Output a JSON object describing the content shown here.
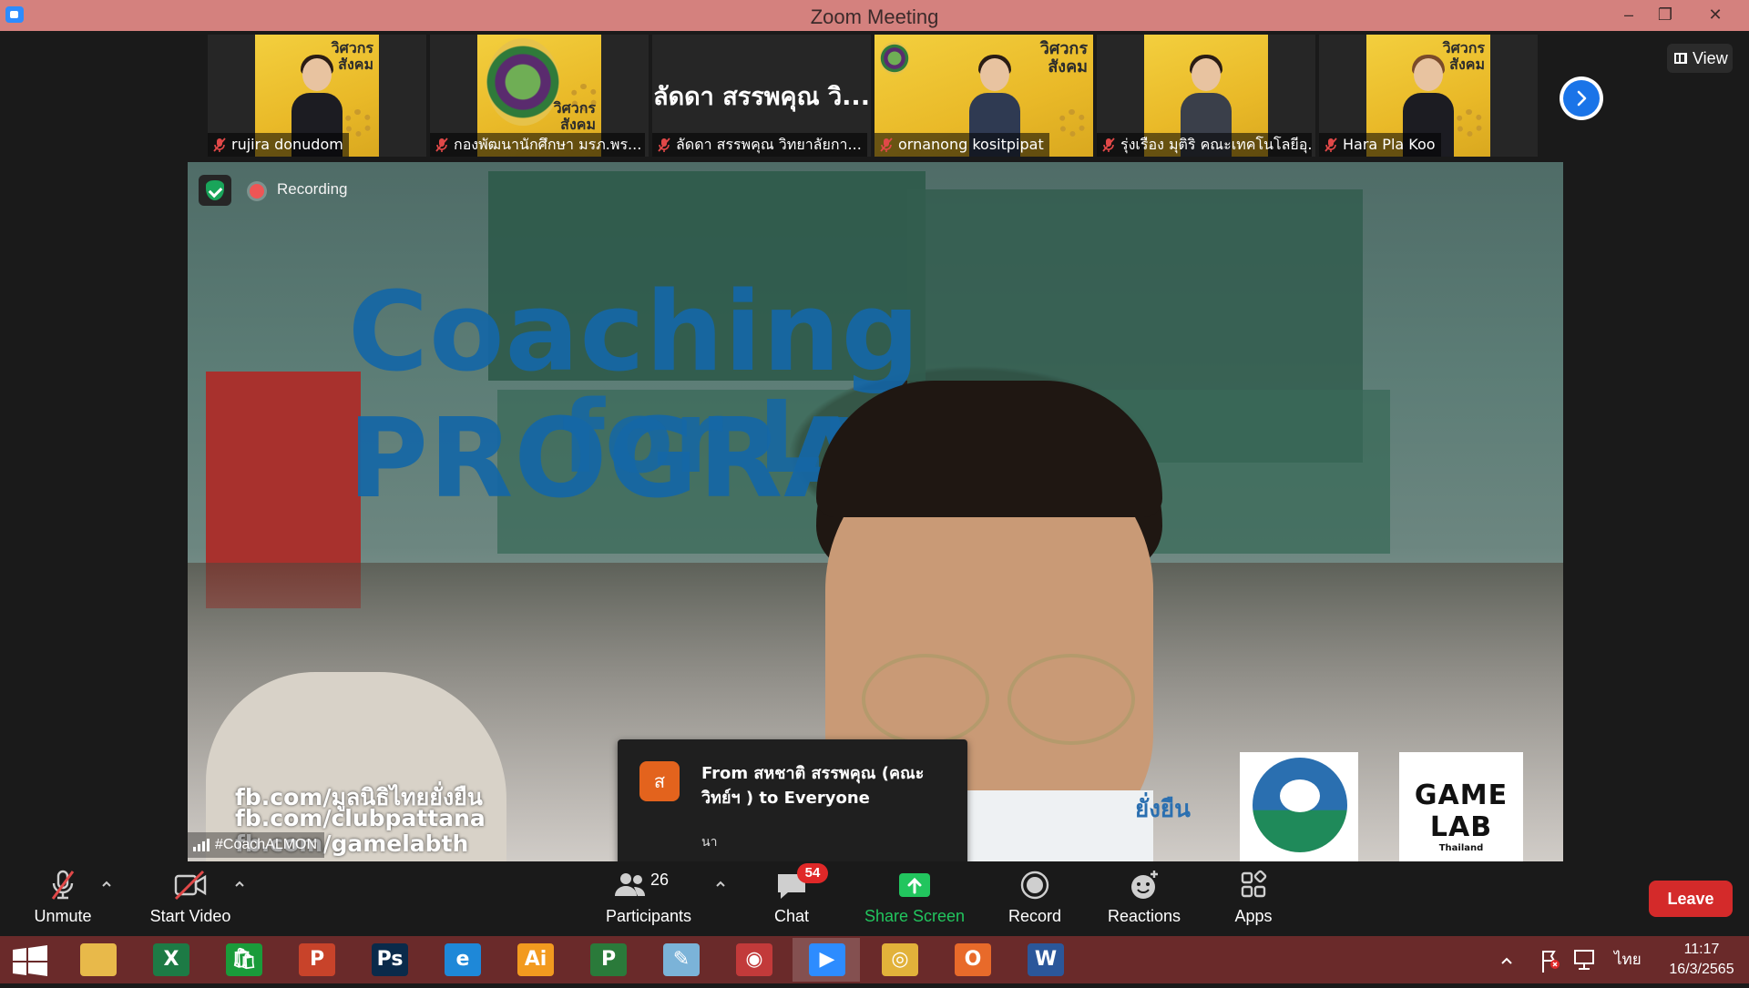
{
  "window": {
    "title": "Zoom Meeting",
    "minimize_glyph": "–",
    "restore_glyph": "❐",
    "close_glyph": "✕"
  },
  "gallery": {
    "view_label": "View",
    "tiles": [
      {
        "name": "rujira donudom",
        "muted": true
      },
      {
        "name": "กองพัฒนานักศึกษา มรภ.พร...",
        "muted": true
      },
      {
        "name": "ลัดดา สรรพคุณ วิทยาลัยกา...",
        "display_title": "ลัดดา สรรพคุณ วิ...",
        "muted": true
      },
      {
        "name": "ornanong kositpipat",
        "muted": true
      },
      {
        "name": "รุ่งเรือง มุติริ คณะเทคโนโลยีอุ...",
        "muted": true
      },
      {
        "name": "Hara Pla Koo",
        "muted": true
      }
    ],
    "tile_logo_text": "วิศวกร สังคม"
  },
  "main_video": {
    "recording_label": "Recording",
    "speaker_name": "#CoachALMON",
    "slide_title": "Coaching PROGRAM",
    "slide_subtitle": "for Lr",
    "fb_lines": [
      "fb.com/มูลนิธิไทยยั่งยืน",
      "fb.com/clubpattana",
      "fb.com/gamelabth"
    ],
    "logo_yy": "ยั่งยืน",
    "logo_game_main": "GAME LAB",
    "logo_game_sub": "Thailand"
  },
  "chat_toast": {
    "avatar_letter": "ส",
    "from_text": "From สหชาติ สรรพคุณ (คณะวิทย์ฯ ) to Everyone",
    "message": "นา"
  },
  "toolbar": {
    "unmute": "Unmute",
    "start_video": "Start Video",
    "participants": "Participants",
    "participants_count": "26",
    "chat": "Chat",
    "chat_badge": "54",
    "share_screen": "Share Screen",
    "record": "Record",
    "reactions": "Reactions",
    "apps": "Apps",
    "leave": "Leave"
  },
  "taskbar": {
    "apps": [
      {
        "name": "file-explorer",
        "glyph": "",
        "color": "#e8b94a"
      },
      {
        "name": "excel",
        "glyph": "X",
        "color": "#1d7a45"
      },
      {
        "name": "store",
        "glyph": "🛍",
        "color": "#1a9b3a"
      },
      {
        "name": "powerpoint",
        "glyph": "P",
        "color": "#c8432a"
      },
      {
        "name": "photoshop",
        "glyph": "Ps",
        "color": "#0a2a4a"
      },
      {
        "name": "internet-explorer",
        "glyph": "e",
        "color": "#1e88d8"
      },
      {
        "name": "illustrator",
        "glyph": "Ai",
        "color": "#f29a1f"
      },
      {
        "name": "project",
        "glyph": "P",
        "color": "#2a7a3a"
      },
      {
        "name": "notepad",
        "glyph": "✎",
        "color": "#7bb3d8"
      },
      {
        "name": "photoscape",
        "glyph": "◉",
        "color": "#c23a3a"
      },
      {
        "name": "zoom",
        "glyph": "▶",
        "color": "#2d8cff"
      },
      {
        "name": "chrome",
        "glyph": "◎",
        "color": "#e2b23a"
      },
      {
        "name": "office",
        "glyph": "O",
        "color": "#e86a2a"
      },
      {
        "name": "word",
        "glyph": "W",
        "color": "#2b579a"
      }
    ],
    "language": "ไทย",
    "time": "11:17",
    "date": "16/3/2565"
  }
}
